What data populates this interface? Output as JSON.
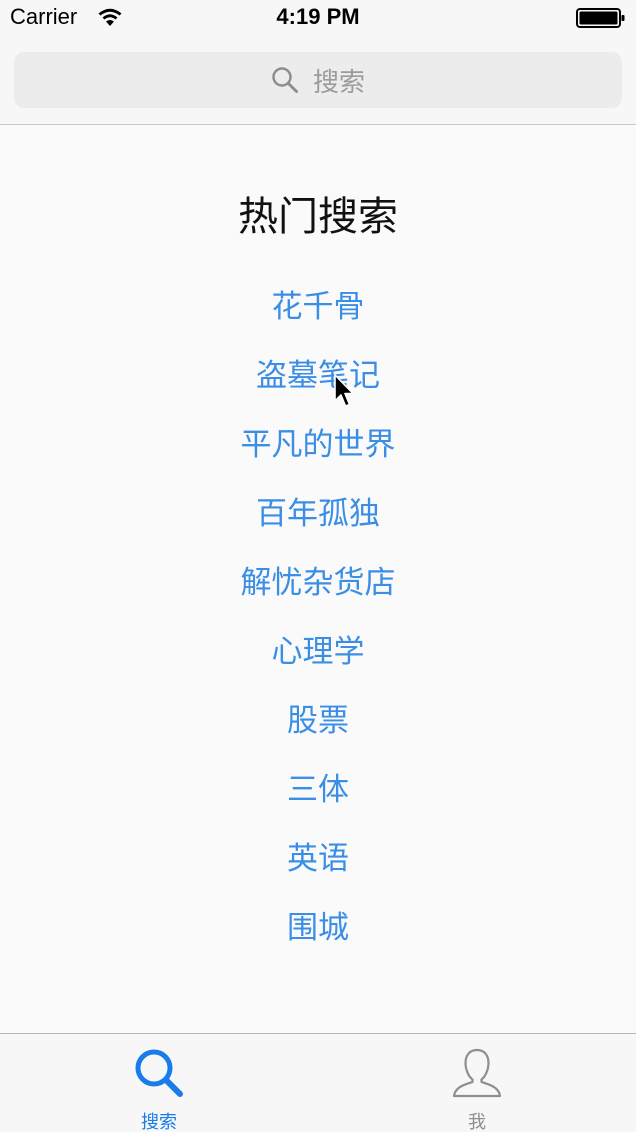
{
  "status_bar": {
    "carrier": "Carrier",
    "time": "4:19 PM"
  },
  "search": {
    "placeholder": "搜索",
    "icon": "search-icon"
  },
  "hot": {
    "title": "热门搜索",
    "items": [
      {
        "label": "花千骨"
      },
      {
        "label": "盗墓笔记"
      },
      {
        "label": "平凡的世界"
      },
      {
        "label": "百年孤独"
      },
      {
        "label": "解忧杂货店"
      },
      {
        "label": "心理学"
      },
      {
        "label": "股票"
      },
      {
        "label": "三体"
      },
      {
        "label": "英语"
      },
      {
        "label": "围城"
      }
    ]
  },
  "tab_bar": {
    "tabs": [
      {
        "label": "搜索",
        "icon": "search-icon",
        "selected": true
      },
      {
        "label": "我",
        "icon": "person-icon",
        "selected": false
      }
    ]
  },
  "colors": {
    "link": "#3a8ee6",
    "tab_active": "#1a7ce8",
    "tab_inactive": "#8e8e8e"
  }
}
